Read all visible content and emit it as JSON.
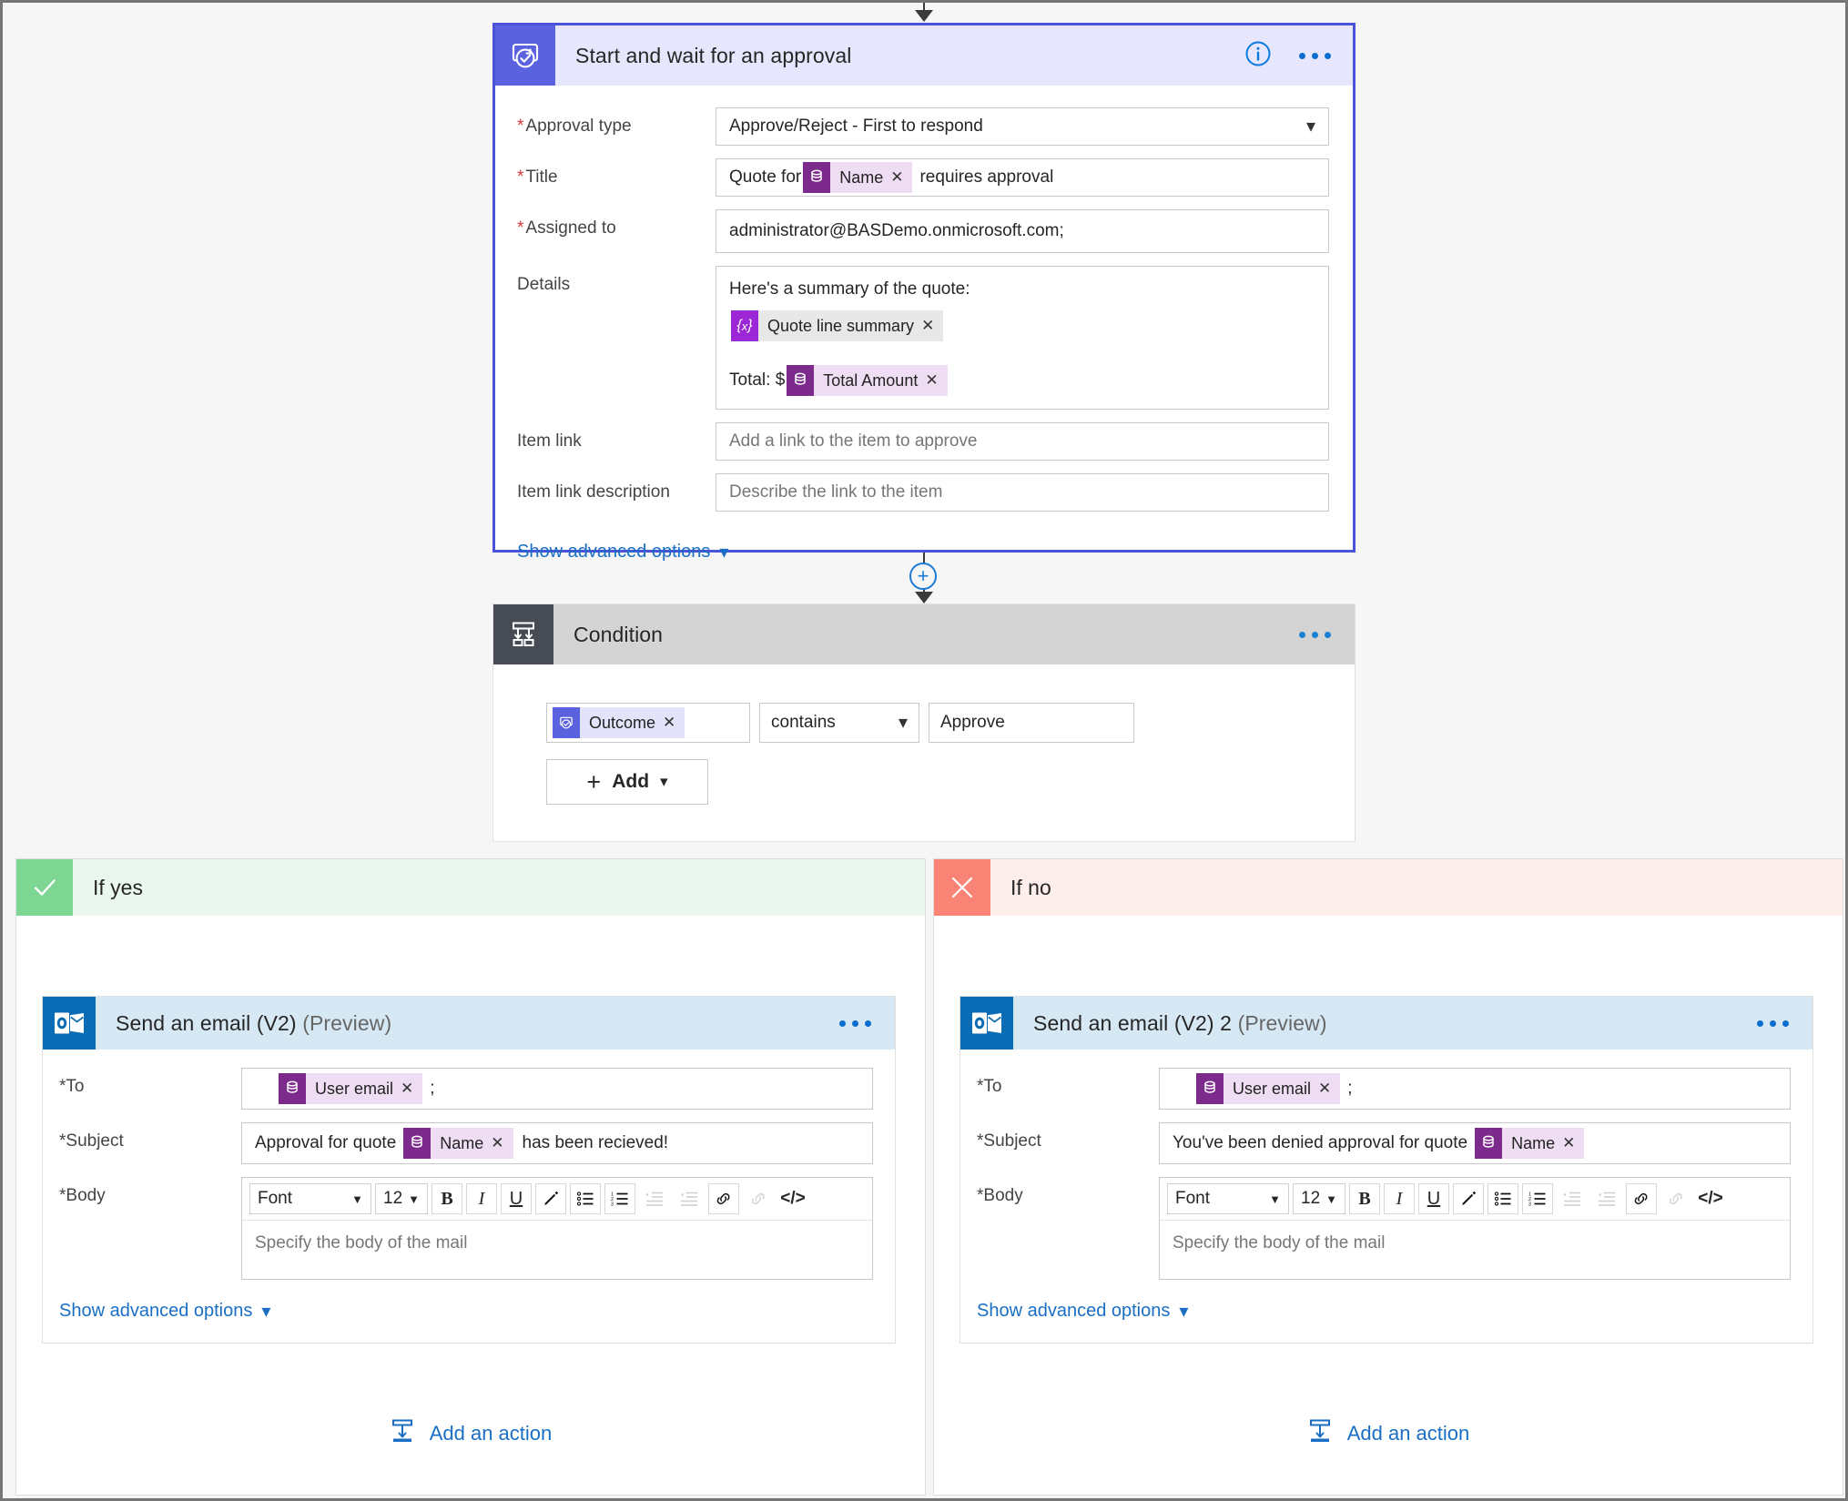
{
  "approval": {
    "title": "Start and wait for an approval",
    "icon": "approval-icon",
    "info_icon": "info-icon",
    "more_icon": "more-options-icon",
    "fields": {
      "approval_type": {
        "label": "Approval type",
        "required": true,
        "value": "Approve/Reject - First to respond"
      },
      "title": {
        "label": "Title",
        "required": true,
        "text_before": "Quote for",
        "token": "Name",
        "text_after": "requires approval"
      },
      "assigned_to": {
        "label": "Assigned to",
        "required": true,
        "value": "administrator@BASDemo.onmicrosoft.com;"
      },
      "details": {
        "label": "Details",
        "line1": "Here's a summary of the quote:",
        "token_expression": "Quote line summary",
        "line2_prefix": "Total: $",
        "token_amount": "Total Amount"
      },
      "item_link": {
        "label": "Item link",
        "placeholder": "Add a link to the item to approve"
      },
      "item_link_description": {
        "label": "Item link description",
        "placeholder": "Describe the link to the item"
      }
    },
    "advanced_label": "Show advanced options"
  },
  "condition": {
    "title": "Condition",
    "icon": "condition-icon",
    "more_icon": "more-options-icon",
    "left_token": "Outcome",
    "operator": "contains",
    "right_value": "Approve",
    "add_label": "Add"
  },
  "connector": {
    "plus_label": "+"
  },
  "branches": [
    {
      "name": "if-yes",
      "label": "If yes",
      "icon": "check-icon",
      "accent": "#7ed693",
      "header_bg": "#eaf7ee",
      "mail": {
        "title": "Send an email (V2)",
        "preview": "(Preview)",
        "icon": "outlook-icon",
        "more_icon": "more-options-icon",
        "to": {
          "label": "To",
          "required": true,
          "token": "User email",
          "suffix": ";"
        },
        "subject": {
          "label": "Subject",
          "required": true,
          "text_before": "Approval for quote",
          "token": "Name",
          "text_after": "has been recieved!"
        },
        "body": {
          "label": "Body",
          "required": true,
          "placeholder": "Specify the body of the mail"
        },
        "advanced_label": "Show advanced options"
      },
      "add_action_label": "Add an action"
    },
    {
      "name": "if-no",
      "label": "If no",
      "icon": "close-icon",
      "accent": "#f98476",
      "header_bg": "#fdeeec",
      "mail": {
        "title": "Send an email (V2) 2",
        "preview": "(Preview)",
        "icon": "outlook-icon",
        "more_icon": "more-options-icon",
        "to": {
          "label": "To",
          "required": true,
          "token": "User email",
          "suffix": ";"
        },
        "subject": {
          "label": "Subject",
          "required": true,
          "text_before": "You've been denied approval for quote",
          "token": "Name",
          "text_after": ""
        },
        "body": {
          "label": "Body",
          "required": true,
          "placeholder": "Specify the body of the mail"
        },
        "advanced_label": "Show advanced options"
      },
      "add_action_label": "Add an action"
    }
  ],
  "rte_toolbar": {
    "font_label": "Font",
    "size_label": "12",
    "buttons": [
      {
        "name": "bold-icon",
        "glyph": "B"
      },
      {
        "name": "italic-icon",
        "glyph": "I"
      },
      {
        "name": "underline-icon",
        "glyph": "U"
      },
      {
        "name": "text-highlight-icon",
        "glyph": "✒"
      },
      {
        "name": "bullet-list-icon",
        "glyph": "☰"
      },
      {
        "name": "numbered-list-icon",
        "glyph": "☰"
      },
      {
        "name": "indent-icon",
        "glyph": "→"
      },
      {
        "name": "outdent-icon",
        "glyph": "←"
      },
      {
        "name": "link-icon",
        "glyph": "🔗"
      },
      {
        "name": "unlink-icon",
        "glyph": "🔗"
      },
      {
        "name": "code-view-icon",
        "glyph": "</>"
      }
    ]
  },
  "colors": {
    "approval_accent": "#5a62e0",
    "condition_accent": "#464b54",
    "outlook_accent": "#0a6cb4",
    "yes_accent": "#7ed693",
    "no_accent": "#f98476",
    "link": "#1a6fc4",
    "required": "#d23b3b",
    "token_purple": "#7c2a8c",
    "expression_purple": "#9b27d6"
  }
}
